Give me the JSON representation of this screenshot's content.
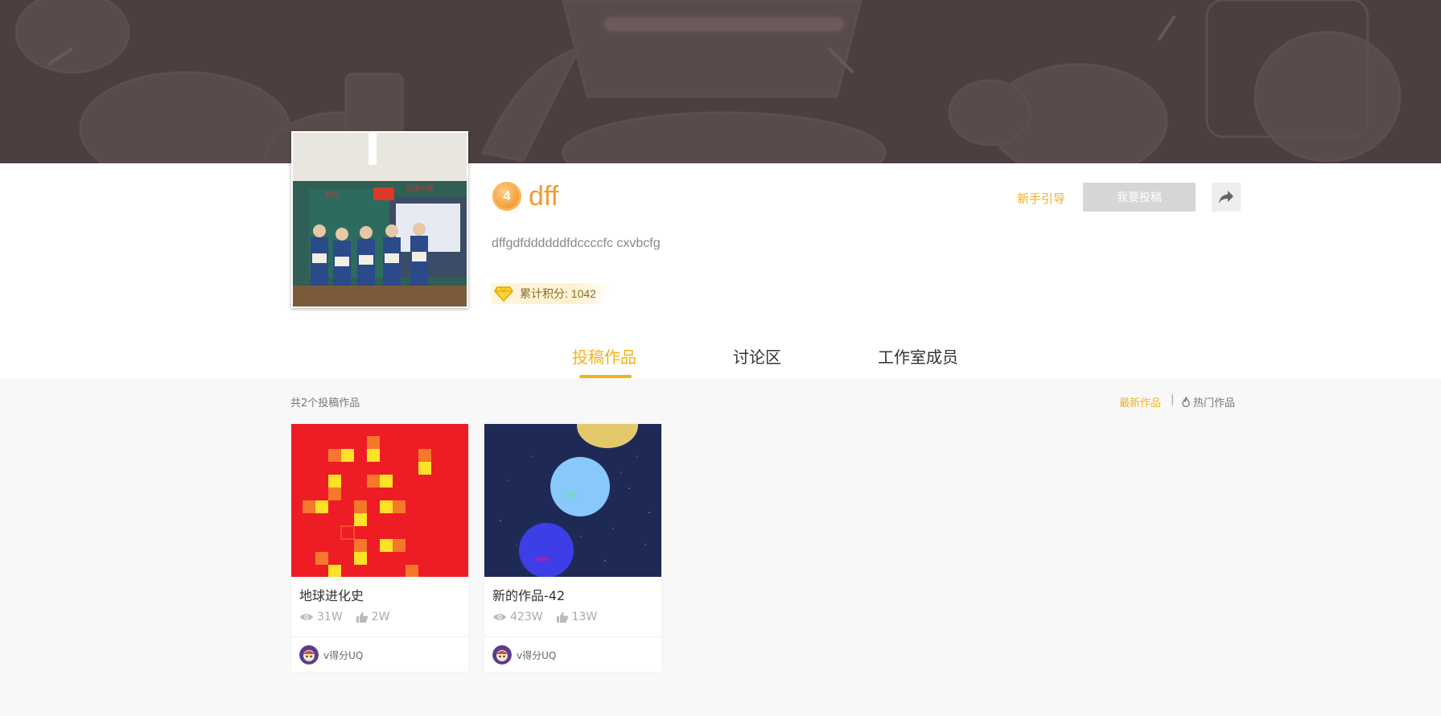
{
  "profile": {
    "level": "4",
    "name": "dff",
    "description": "dffgdfddddddfdccccfc cxvbcfg",
    "score_text": "累计积分: 1042",
    "guide_label": "新手引导",
    "submit_label": "我要投稿"
  },
  "tabs": [
    {
      "label": "投稿作品",
      "active": true
    },
    {
      "label": "讨论区",
      "active": false
    },
    {
      "label": "工作室成员",
      "active": false
    }
  ],
  "works": {
    "count_text": "共2个投稿作品",
    "sort_latest": "最新作品",
    "sort_separator": "|",
    "sort_hot": "热门作品",
    "items": [
      {
        "title": "地球进化史",
        "views": "31W",
        "likes": "2W",
        "author": "v得分UQ"
      },
      {
        "title": "新的作品-42",
        "views": "423W",
        "likes": "13W",
        "author": "v得分UQ"
      }
    ]
  },
  "colors": {
    "accent": "#f5b21c",
    "name_orange": "#f39a35",
    "banner": "#4a3d3d"
  }
}
